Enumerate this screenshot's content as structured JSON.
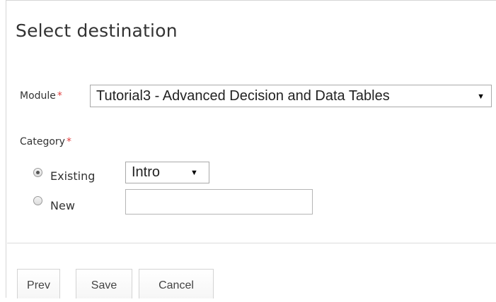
{
  "dialog": {
    "title": "Select destination"
  },
  "module": {
    "label": "Module",
    "required_mark": "*",
    "selected": "Tutorial3 - Advanced Decision and Data Tables",
    "arrow_icon": "▼"
  },
  "category": {
    "label": "Category",
    "required_mark": "*",
    "options": [
      {
        "label": "Existing",
        "checked": true
      },
      {
        "label": "New",
        "checked": false
      }
    ],
    "existing_selected": "Intro",
    "arrow_icon": "▼",
    "new_value": ""
  },
  "buttons": {
    "prev": "Prev",
    "save": "Save",
    "cancel": "Cancel"
  }
}
